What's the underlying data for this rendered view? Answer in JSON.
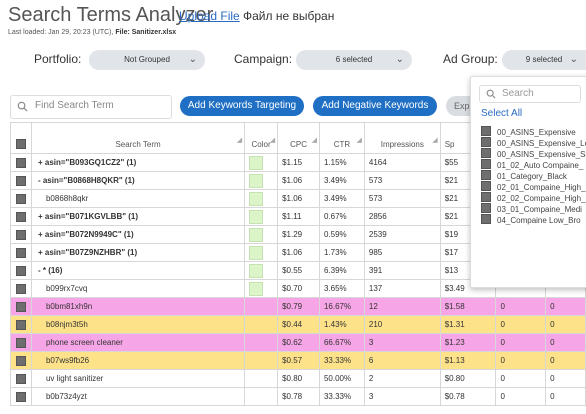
{
  "app": {
    "title": "Search Terms Analyzer",
    "upload_link": "Upload File",
    "file_status": "Файл не выбран",
    "loaded_prefix": "Last loaded: Jan 29, 20:23 (UTC),",
    "file_label": "File: Sanitizer.xlsx"
  },
  "filters": {
    "portfolio_label": "Portfolio:",
    "portfolio_value": "Not Grouped",
    "campaign_label": "Campaign:",
    "campaign_value": "6 selected",
    "adgroup_label": "Ad Group:",
    "adgroup_value": "9 selected"
  },
  "toolbar": {
    "search_placeholder": "Find Search Term",
    "add_targeting": "Add Keywords Targeting",
    "add_negative": "Add Negative Keywords",
    "export_partial": "Exp"
  },
  "table": {
    "headers": {
      "term": "Search Term",
      "color": "Color",
      "cpc": "CPC",
      "ctr": "CTR",
      "impressions": "Impressions",
      "spend_partial": "Sp"
    },
    "rows": [
      {
        "term": "+ asin=\"B093GQ1CZ2\" (1)",
        "cpc": "$1.15",
        "ctr": "1.15%",
        "impr": "4164",
        "sp": "$55",
        "c6": "",
        "c7": "",
        "style": "grp",
        "swatch": true
      },
      {
        "term": "- asin=\"B0868H8QKR\" (1)",
        "cpc": "$1.06",
        "ctr": "3.49%",
        "impr": "573",
        "sp": "$21",
        "c6": "",
        "c7": "",
        "style": "grp",
        "swatch": true
      },
      {
        "term": "b0868h8qkr",
        "cpc": "$1.06",
        "ctr": "3.49%",
        "impr": "573",
        "sp": "$21",
        "c6": "",
        "c7": "",
        "style": "",
        "swatch": true,
        "indent": true
      },
      {
        "term": "+ asin=\"B071KGVLBB\" (1)",
        "cpc": "$1.11",
        "ctr": "0.67%",
        "impr": "2856",
        "sp": "$21",
        "c6": "",
        "c7": "",
        "style": "grp",
        "swatch": true
      },
      {
        "term": "+ asin=\"B072N9949C\" (1)",
        "cpc": "$1.29",
        "ctr": "0.59%",
        "impr": "2539",
        "sp": "$19",
        "c6": "",
        "c7": "",
        "style": "grp",
        "swatch": true
      },
      {
        "term": "+ asin=\"B07Z9NZHBR\" (1)",
        "cpc": "$1.06",
        "ctr": "1.73%",
        "impr": "985",
        "sp": "$17",
        "c6": "",
        "c7": "",
        "style": "grp",
        "swatch": true
      },
      {
        "term": "- * (16)",
        "cpc": "$0.55",
        "ctr": "6.39%",
        "impr": "391",
        "sp": "$13",
        "c6": "",
        "c7": "",
        "style": "grp",
        "swatch": true
      },
      {
        "term": "b099rx7cvq",
        "cpc": "$0.70",
        "ctr": "3.65%",
        "impr": "137",
        "sp": "$3.49",
        "c6": "",
        "c7": "",
        "style": "",
        "swatch": true,
        "indent": true
      },
      {
        "term": "b0bm81xh9n",
        "cpc": "$0.79",
        "ctr": "16.67%",
        "impr": "12",
        "sp": "$1.58",
        "c6": "0",
        "c7": "0",
        "style": "pink",
        "swatch": false,
        "indent": true
      },
      {
        "term": "b08njm3t5h",
        "cpc": "$0.44",
        "ctr": "1.43%",
        "impr": "210",
        "sp": "$1.31",
        "c6": "0",
        "c7": "0",
        "style": "yellow",
        "swatch": false,
        "indent": true
      },
      {
        "term": "phone screen cleaner",
        "cpc": "$0.62",
        "ctr": "66.67%",
        "impr": "3",
        "sp": "$1.23",
        "c6": "0",
        "c7": "0",
        "style": "pink",
        "swatch": false,
        "indent": true
      },
      {
        "term": "b07ws9fb26",
        "cpc": "$0.57",
        "ctr": "33.33%",
        "impr": "6",
        "sp": "$1.13",
        "c6": "0",
        "c7": "0",
        "style": "yellow",
        "swatch": false,
        "indent": true
      },
      {
        "term": "uv light sanitizer",
        "cpc": "$0.80",
        "ctr": "50.00%",
        "impr": "2",
        "sp": "$0.80",
        "c6": "0",
        "c7": "0",
        "style": "",
        "swatch": false,
        "indent": true
      },
      {
        "term": "b0b73z4yzt",
        "cpc": "$0.78",
        "ctr": "33.33%",
        "impr": "3",
        "sp": "$0.78",
        "c6": "0",
        "c7": "0",
        "style": "",
        "swatch": false,
        "indent": true
      }
    ]
  },
  "dropdown": {
    "search_placeholder": "Search",
    "select_all": "Select All",
    "items": [
      "00_ASINS_Expensive",
      "00_ASINS_Expensive_Lo",
      "00_ASINS_Expensive_Sa",
      "01_02_Auto Compaine_",
      "01_Category_Black",
      "02_01_Compaine_High_",
      "02_02_Compaine_High_",
      "03_01_Compaine_Medi",
      "04_Compaine Low_Bro"
    ]
  },
  "colors": {
    "accent": "#1f6fc4",
    "pink_row": "#f6a6e6",
    "yellow_row": "#fde28a",
    "swatch": "#dbf5c8"
  }
}
